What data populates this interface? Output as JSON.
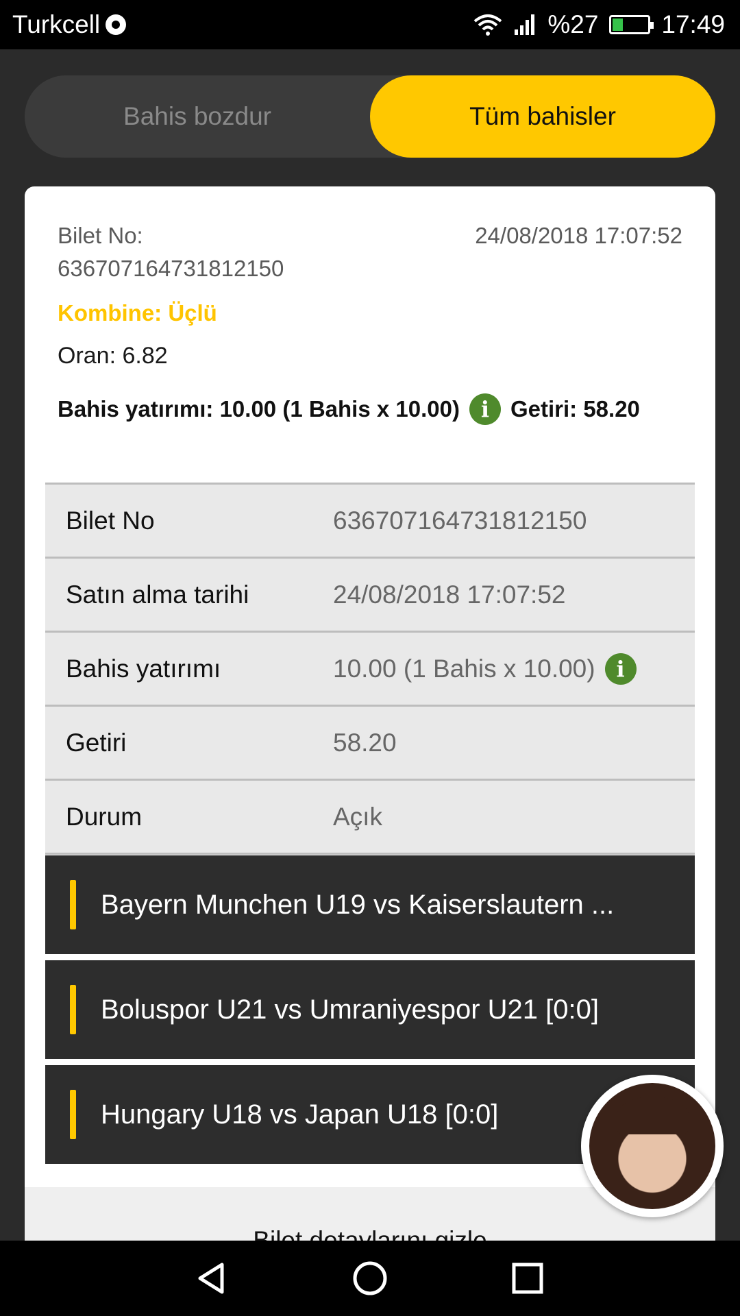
{
  "status_bar": {
    "carrier": "Turkcell",
    "battery": "%27",
    "time": "17:49"
  },
  "tabs": {
    "cash_out": "Bahis bozdur",
    "all_bets": "Tüm bahisler",
    "active": "all_bets"
  },
  "ticket": {
    "label": "Bilet No:",
    "number": "636707164731812150",
    "datetime": "24/08/2018 17:07:52",
    "combo": "Kombine: Üçlü",
    "odds": "Oran: 6.82",
    "stake_summary": "Bahis yatırımı: 10.00 (1 Bahis x 10.00)",
    "return_summary": "Getiri: 58.20"
  },
  "details": [
    {
      "key": "Bilet No",
      "value": "636707164731812150"
    },
    {
      "key": "Satın alma tarihi",
      "value": "24/08/2018 17:07:52"
    },
    {
      "key": "Bahis yatırımı",
      "value": "10.00 (1 Bahis x 10.00)"
    },
    {
      "key": "Getiri",
      "value": "58.20"
    },
    {
      "key": "Durum",
      "value": "Açık"
    }
  ],
  "events": [
    "Bayern Munchen U19 vs Kaiserslautern ...",
    "Boluspor U21 vs Umraniyespor U21 [0:0]",
    "Hungary U18 vs Japan U18 [0:0]"
  ],
  "hide_details": "Bilet detaylarını gizle",
  "colors": {
    "accent": "#ffc800",
    "info": "#4f8a2c",
    "dark_bg": "#2b2b2b"
  },
  "icons": [
    "wifi-icon",
    "signal-icon",
    "battery-icon",
    "info-icon",
    "back-icon",
    "home-icon",
    "recents-icon",
    "avatar"
  ]
}
